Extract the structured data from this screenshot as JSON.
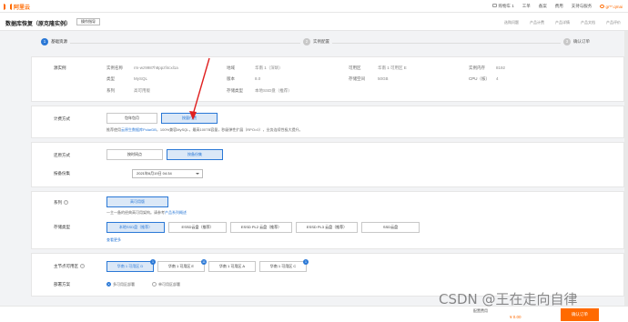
{
  "header": {
    "logo_text": "阿里云",
    "cart": "购物车 1",
    "ticket": "工单",
    "filing": "备案",
    "enterprise": "费用",
    "support": "支持与服务",
    "user": "gr**.qmai"
  },
  "title": {
    "page_title": "数据库恢复（原克隆实例）",
    "guide_button": "操作指导",
    "links": [
      "选购问题",
      "产品计费",
      "产品详情",
      "产品文档",
      "产品评价"
    ]
  },
  "steps": [
    {
      "num": "1",
      "label": "基础资源"
    },
    {
      "num": "2",
      "label": "实例配置"
    },
    {
      "num": "3",
      "label": "确认订单"
    }
  ],
  "source": {
    "label": "源实例",
    "instance_name_key": "实例名称",
    "instance_name_val": "rm-wz9987h8ppzf4cxl1a",
    "type_key": "类型",
    "type_val": "MySQL",
    "series_key": "系列",
    "series_val": "高可用版",
    "region_key": "地域",
    "region_val": "华南 1（深圳）",
    "version_key": "版本",
    "version_val": "8.0",
    "storage_type_key": "存储类型",
    "storage_type_val": "本地SSD盘（推荐）",
    "zone_key": "可用区",
    "zone_val": "华南 1 可用区 E",
    "storage_space_key": "存储空间",
    "storage_space_val": "50GB",
    "memory_key": "实例内存",
    "memory_val": "8192",
    "cpu_key": "CPU（核）",
    "cpu_val": "4"
  },
  "billing": {
    "label": "计费方式",
    "options": [
      "包年包月",
      "按量付费"
    ],
    "note_prefix": "推荐使用",
    "note_link": "云原生数据库PolarDB",
    "note_suffix": "，100%兼容MySQL，最高100TB容量，秒级弹性扩展（RPO=0），业务连续性极大提升。"
  },
  "restore": {
    "label": "还原方式",
    "options": [
      "按时间点",
      "按备份集"
    ],
    "backup_label": "按备份集",
    "backup_value": "2021年6月19日 04:34"
  },
  "series": {
    "label": "系列",
    "help": "?",
    "option": "高可用版",
    "note_prefix": "一主一备的经典高可用架构。请参考",
    "note_link": "产品系列概述"
  },
  "storage": {
    "label": "存储类型",
    "options": [
      "本地SSD盘（推荐）",
      "ESSD云盘（推荐）",
      "ESSD PL2 云盘（推荐）",
      "ESSD PL3 云盘（推荐）",
      "SSD云盘"
    ],
    "link": "查看更多"
  },
  "zone": {
    "label": "主节点可用区",
    "help": "?",
    "options": [
      "华南 1 可用区 D",
      "华南 1 可用区 E",
      "华南 1 可用区 A",
      "华南 1 可用区 C"
    ],
    "badges": [
      "1",
      "11",
      "",
      "1"
    ]
  },
  "deploy": {
    "label": "部署方案",
    "options": [
      "多可用区部署",
      "单可用区部署"
    ]
  },
  "bottom": {
    "price_label": "配置费用",
    "price_value": "¥ 0.00",
    "buy_button": "确认订单"
  },
  "watermark": "CSDN @王在走向自律"
}
